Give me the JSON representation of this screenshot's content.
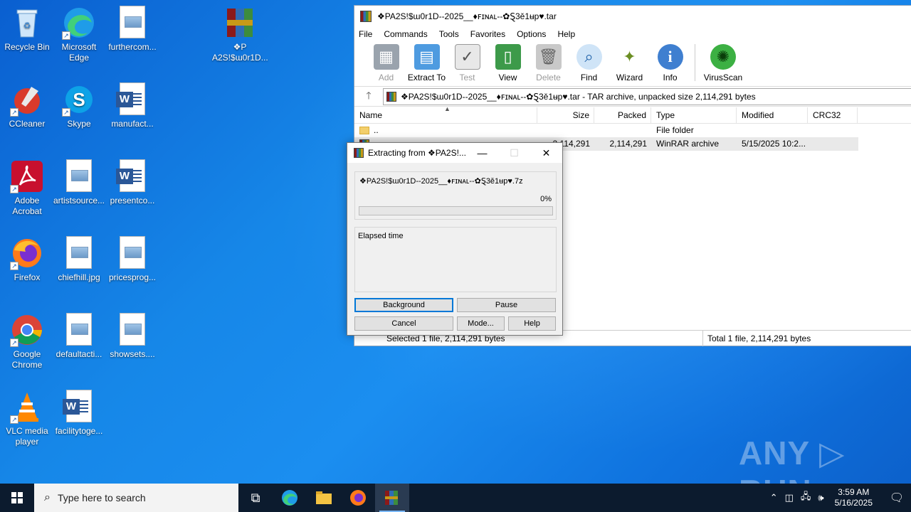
{
  "desktop": {
    "icons": [
      {
        "label": "Recycle Bin"
      },
      {
        "label": "Microsoft Edge"
      },
      {
        "label": "furthercom..."
      },
      {
        "label": "❖P A2S!$ɯ0r1D..."
      },
      {
        "label": "CCleaner"
      },
      {
        "label": "Skype"
      },
      {
        "label": "manufact..."
      },
      {
        "label": "Adobe Acrobat"
      },
      {
        "label": "artistsource..."
      },
      {
        "label": "presentco..."
      },
      {
        "label": "Firefox"
      },
      {
        "label": "chiefhill.jpg"
      },
      {
        "label": "pricesprog..."
      },
      {
        "label": "Google Chrome"
      },
      {
        "label": "defaultacti..."
      },
      {
        "label": "showsets...."
      },
      {
        "label": "VLC media player"
      },
      {
        "label": "facilitytoge..."
      }
    ]
  },
  "winrar": {
    "title": "❖PA2S!$ɯ0r1D--2025__♦ꜰɪɴᴀʟ--✿Ȿ3ě1ʉp♥.tar",
    "menu": [
      "File",
      "Commands",
      "Tools",
      "Favorites",
      "Options",
      "Help"
    ],
    "toolbar": [
      {
        "label": "Add",
        "icon": "add-icon"
      },
      {
        "label": "Extract To",
        "icon": "extract-to-icon"
      },
      {
        "label": "Test",
        "icon": "test-icon"
      },
      {
        "label": "View",
        "icon": "view-icon"
      },
      {
        "label": "Delete",
        "icon": "delete-icon"
      },
      {
        "label": "Find",
        "icon": "find-icon"
      },
      {
        "label": "Wizard",
        "icon": "wizard-icon"
      },
      {
        "label": "Info",
        "icon": "info-icon"
      },
      {
        "label": "VirusScan",
        "icon": "virusscan-icon"
      }
    ],
    "address": "❖PA2S!$ɯ0r1D--2025__♦ꜰɪɴᴀʟ--✿Ȿ3ě1ʉp♥.tar - TAR archive, unpacked size 2,114,291 bytes",
    "columns": {
      "name": "Name",
      "size": "Size",
      "packed": "Packed",
      "type": "Type",
      "modified": "Modified",
      "crc": "CRC32"
    },
    "rows": [
      {
        "name": "..",
        "size": "",
        "packed": "",
        "type": "File folder",
        "modified": ""
      },
      {
        "name": "",
        "size": "2,114,291",
        "packed": "2,114,291",
        "type": "WinRAR archive",
        "modified": "5/15/2025 10:2..."
      }
    ],
    "status_left": "Selected 1 file, 2,114,291 bytes",
    "status_right": "Total 1 file, 2,114,291 bytes"
  },
  "dialog": {
    "title": "Extracting from ❖PA2S!...",
    "filename": "❖PA2S!$ɯ0r1D--2025__♦ꜰɪɴᴀʟ--✿Ȿ3ě1ʉp♥.7z",
    "percent": "0%",
    "progress": 0,
    "elapsed_label": "Elapsed time",
    "buttons": {
      "background": "Background",
      "pause": "Pause",
      "cancel": "Cancel",
      "mode": "Mode...",
      "help": "Help"
    }
  },
  "watermark": "ANY ▷ RUN",
  "taskbar": {
    "search_placeholder": "Type here to search",
    "time": "3:59 AM",
    "date": "5/16/2025"
  },
  "colors": {
    "accent": "#0078d7",
    "progress": "#06b025",
    "taskbar": "#0c1b2e"
  }
}
